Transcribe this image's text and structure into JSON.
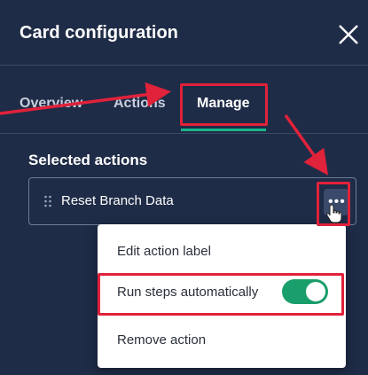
{
  "panel": {
    "title": "Card configuration",
    "close_icon": "close-icon"
  },
  "tabs": [
    {
      "label": "Overview",
      "active": false
    },
    {
      "label": "Actions",
      "active": false
    },
    {
      "label": "Manage",
      "active": true
    }
  ],
  "section": {
    "title": "Selected actions"
  },
  "action_row": {
    "label": "Reset Branch Data",
    "drag_icon": "drag-handle-icon",
    "more_label": "•••"
  },
  "menu": {
    "items": [
      {
        "label": "Edit action label"
      },
      {
        "label": "Run steps automatically",
        "toggle_on": true
      },
      {
        "label": "Remove action"
      }
    ]
  },
  "colors": {
    "panel_bg": "#1f2c47",
    "accent": "#19b58a",
    "toggle_on": "#1a9e6b",
    "highlight": "#e0223a"
  }
}
